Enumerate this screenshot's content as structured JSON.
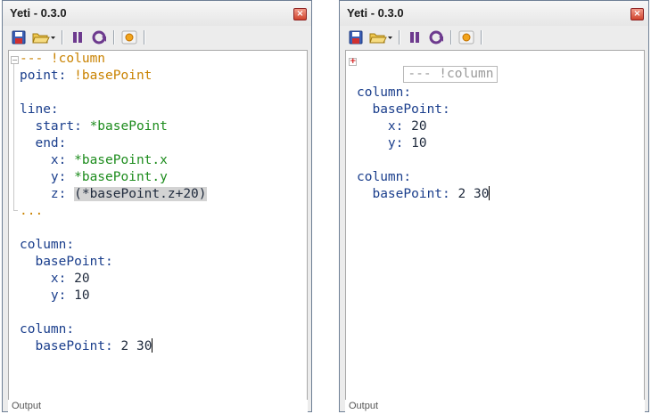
{
  "windows": [
    {
      "title": "Yeti - 0.3.0",
      "close_glyph": "×",
      "status": "Output",
      "collapsed_header": false,
      "lines": [
        [
          [
            "--- ",
            "o"
          ],
          [
            "!column",
            "o"
          ]
        ],
        [
          [
            "point: ",
            "k"
          ],
          [
            "!basePoint",
            "o"
          ]
        ],
        [],
        [
          [
            "line:",
            "k"
          ]
        ],
        [
          [
            "  start: ",
            "k"
          ],
          [
            "*basePoint",
            "g"
          ]
        ],
        [
          [
            "  end:",
            "k"
          ]
        ],
        [
          [
            "    x: ",
            "k"
          ],
          [
            "*basePoint.x",
            "g"
          ]
        ],
        [
          [
            "    y: ",
            "k"
          ],
          [
            "*basePoint.y",
            "g"
          ]
        ],
        [
          [
            "    z: ",
            "k"
          ],
          [
            "(*basePoint.z+20)",
            "sel"
          ]
        ],
        [
          [
            "...",
            "o"
          ]
        ],
        [],
        [
          [
            "column:",
            "k"
          ]
        ],
        [
          [
            "  basePoint:",
            "k"
          ]
        ],
        [
          [
            "    x: ",
            "k"
          ],
          [
            "20",
            "v"
          ]
        ],
        [
          [
            "    y: ",
            "k"
          ],
          [
            "10",
            "v"
          ]
        ],
        [],
        [
          [
            "column:",
            "k"
          ]
        ],
        [
          [
            "  basePoint: ",
            "k"
          ],
          [
            "2 30",
            "v"
          ],
          [
            "",
            "caret"
          ]
        ]
      ]
    },
    {
      "title": "Yeti - 0.3.0",
      "close_glyph": "×",
      "status": "Output",
      "collapsed_header": true,
      "collapsed_text": "--- !column",
      "lines": [
        [],
        [],
        [
          [
            "column:",
            "k"
          ]
        ],
        [
          [
            "  basePoint:",
            "k"
          ]
        ],
        [
          [
            "    x: ",
            "k"
          ],
          [
            "20",
            "v"
          ]
        ],
        [
          [
            "    y: ",
            "k"
          ],
          [
            "10",
            "v"
          ]
        ],
        [],
        [
          [
            "column:",
            "k"
          ]
        ],
        [
          [
            "  basePoint: ",
            "k"
          ],
          [
            "2 30",
            "v"
          ],
          [
            "",
            "caret"
          ]
        ]
      ]
    }
  ],
  "toolbar_icons": [
    "save-icon",
    "open-folder-icon",
    "pause-icon",
    "reload-icon",
    "run-icon"
  ]
}
